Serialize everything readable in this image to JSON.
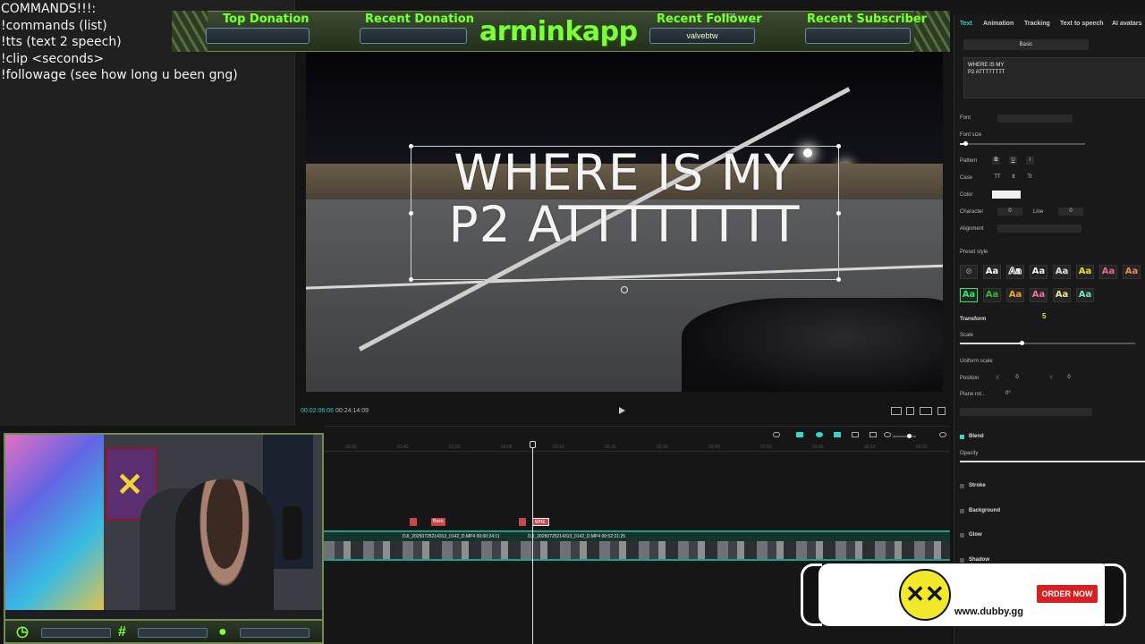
{
  "commands": {
    "lines": [
      "COMMANDS!!!:",
      "!commands (list)",
      "!tts (text 2 speech)",
      "!clip <seconds>",
      "!followage (see how long u been gng)"
    ]
  },
  "banner": {
    "counter": "0726",
    "title": "arminkapp",
    "top_donation_label": "Top Donation",
    "top_donation_value": "",
    "recent_donation_label": "Recent Donation",
    "recent_donation_value": "",
    "recent_follower_label": "Recent Follower",
    "recent_follower_value": "valvebtw",
    "recent_subscriber_label": "Recent Subscriber",
    "recent_subscriber_value": ""
  },
  "preview": {
    "overlay_line1": "WHERE IS MY",
    "overlay_line2": "P2 ATTTTTTTT"
  },
  "player": {
    "current_time": "00:02:06:06",
    "total_time": "00:24:14:09"
  },
  "properties": {
    "tabs": [
      "Text",
      "Animation",
      "Tracking",
      "Text to speech",
      "AI avatars"
    ],
    "subtab": "Basic",
    "text_value": "WHERE IS MY\nP2 ATTTTTTTT",
    "font_label": "Font",
    "font_size_label": "Font size",
    "pattern_label": "Pattern",
    "pattern_buttons": [
      "B",
      "U",
      "I"
    ],
    "case_label": "Case",
    "case_buttons": [
      "TT",
      "tt",
      "Tt"
    ],
    "color_label": "Color",
    "character_label": "Character",
    "character_value": "0",
    "line_label": "Line",
    "line_value": "0",
    "alignment_label": "Alignment",
    "preset_style_label": "Preset style",
    "preset_glyph": "Aa",
    "transform_label": "Transform",
    "transform_badge": "5",
    "scale_label": "Scale",
    "uniform_scale_label": "Uniform scale",
    "position_label": "Position",
    "position_x_label": "X",
    "position_x": "0",
    "position_y_label": "Y",
    "position_y": "0",
    "plane_rot_label": "Plane rot...",
    "plane_rot_value": "0°",
    "blend_label": "Blend",
    "opacity_label": "Opacity",
    "stroke_label": "Stroke",
    "background_label": "Background",
    "glow_label": "Glow",
    "shadow_label": "Shadow",
    "font_size_level": 0.04,
    "scale_level": 0.35
  },
  "timeline": {
    "ruler_ticks": [
      "00:00",
      "01:40",
      "01:50",
      "02:00",
      "02:10",
      "02:20",
      "02:30",
      "02:40",
      "02:50",
      "03:00",
      "03:10",
      "03:20"
    ],
    "text_clip_1": "Basic",
    "text_clip_2": "WHE",
    "video_clip_1": "DJI_20250725214313_0142_D.MP4   00:00:24:11",
    "video_clip_2": "DJI_20250725214313_0142_D.MP4   00:02:21:25"
  },
  "ad": {
    "url": "www.dubby.gg",
    "button": "ORDER NOW"
  },
  "colors": {
    "accent_green": "#7dff3a",
    "editor_accent": "#31d9c9",
    "clip_red": "#c5494a"
  }
}
